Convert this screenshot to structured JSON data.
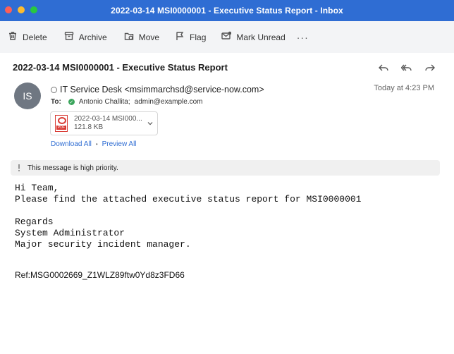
{
  "window": {
    "title": "2022-03-14 MSI0000001 - Executive Status Report - Inbox"
  },
  "toolbar": {
    "delete_label": "Delete",
    "archive_label": "Archive",
    "move_label": "Move",
    "flag_label": "Flag",
    "mark_unread_label": "Mark Unread",
    "more_label": "···"
  },
  "message": {
    "subject": "2022-03-14 MSI0000001 - Executive Status Report",
    "avatar_initials": "IS",
    "from": "IT Service Desk <msimmarchsd@service-now.com>",
    "timestamp": "Today at 4:23 PM",
    "to_label": "To:",
    "to_recipient_1": "Antonio Challita;",
    "to_recipient_2": "admin@example.com",
    "attachment": {
      "name": "2022-03-14 MSI000...",
      "size": "121.8 KB",
      "type_label": "PDF"
    },
    "download_all": "Download All",
    "separator": "•",
    "preview_all": "Preview All",
    "priority_text": "This message is high priority.",
    "body": "Hi Team,\nPlease find the attached executive status report for MSI0000001\n\nRegards\nSystem Administrator\nMajor security incident manager.",
    "ref": "Ref:MSG0002669_Z1WLZ89ftw0Yd8z3FD66"
  },
  "colors": {
    "titlebar": "#2f6dd3",
    "toolbar": "#f3f4f6",
    "link": "#2f6dd3",
    "avatar": "#6f7782",
    "priority_banner": "#f0f0f0"
  }
}
